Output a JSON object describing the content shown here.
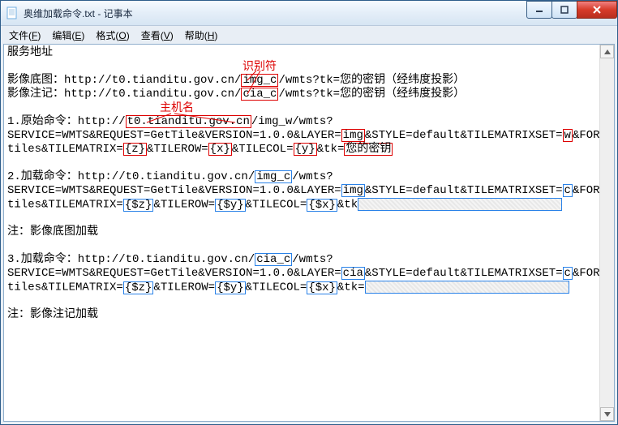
{
  "window": {
    "title": "奥维加载命令.txt - 记事本"
  },
  "menu": {
    "file": "文件(F)",
    "edit": "编辑(E)",
    "format": "格式(O)",
    "view": "查看(V)",
    "help": "帮助(H)"
  },
  "annotations": {
    "identifier": "识别符",
    "hostname": "主机名"
  },
  "content": {
    "l1": "服务地址",
    "l3a": "影像底图：http://t0.tianditu.gov.cn/",
    "l3b": "img_c",
    "l3c": "/wmts?tk=您的密钥（经纬度投影）",
    "l4a": "影像注记：http://t0.tianditu.gov.cn/",
    "l4b": "cia_c",
    "l4c": "/wmts?tk=您的密钥（经纬度投影）",
    "l6a": "1.原始命令：http://",
    "l6b": "t0.tianditu.gov.cn",
    "l6c": "/img_w/wmts?",
    "l7a": "SERVICE=WMTS&REQUEST=GetTile&VERSION=1.0.0&LAYER=",
    "l7b": "img",
    "l7c": "&STYLE=default&TILEMATRIXSET=",
    "l7d": "w",
    "l7e": "&FORMAT=",
    "l8a": "tiles&TILEMATRIX=",
    "l8b": "{z}",
    "l8c": "&TILEROW=",
    "l8d": "{x}",
    "l8e": "&TILECOL=",
    "l8f": "{y}",
    "l8g": "&tk=",
    "l8h": "您的密钥",
    "l10a": "2.加载命令：http://t0.tianditu.gov.cn/",
    "l10b": "img_c",
    "l10c": "/wmts?",
    "l11a": "SERVICE=WMTS&REQUEST=GetTile&VERSION=1.0.0&LAYER=",
    "l11b": "img",
    "l11c": "&STYLE=default&TILEMATRIXSET=",
    "l11d": "c",
    "l11e": "&FORMAT=",
    "l12a": "tiles&TILEMATRIX=",
    "l12b": "{$z}",
    "l12c": "&TILEROW=",
    "l12d": "{$y}",
    "l12e": "&TILECOL=",
    "l12f": "{$x}",
    "l12g": "&tk",
    "l14": "注：影像底图加载",
    "l16a": "3.加载命令：http://t0.tianditu.gov.cn/",
    "l16b": "cia_c",
    "l16c": "/wmts?",
    "l17a": "SERVICE=WMTS&REQUEST=GetTile&VERSION=1.0.0&LAYER=",
    "l17b": "cia",
    "l17c": "&STYLE=default&TILEMATRIXSET=",
    "l17d": "c",
    "l17e": "&FORMAT=",
    "l18a": "tiles&TILEMATRIX=",
    "l18b": "{$z}",
    "l18c": "&TILEROW=",
    "l18d": "{$y}",
    "l18e": "&TILECOL=",
    "l18f": "{$x}",
    "l18g": "&tk=",
    "l20": "注：影像注记加载"
  }
}
